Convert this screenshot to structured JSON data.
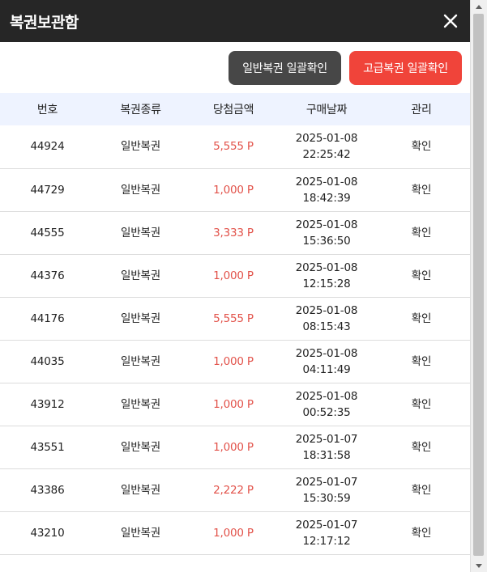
{
  "header": {
    "title": "복권보관함",
    "close_icon": "close-icon"
  },
  "toolbar": {
    "normal_confirm_label": "일반복권 일괄확인",
    "premium_confirm_label": "고급복권 일괄확인"
  },
  "table": {
    "headers": [
      "번호",
      "복권종류",
      "당첨금액",
      "구매날짜",
      "관리"
    ],
    "rows": [
      {
        "number": "44924",
        "type": "일반복권",
        "amount": "5,555 P",
        "date": "2025-01-08",
        "time": "22:25:42",
        "action": "확인"
      },
      {
        "number": "44729",
        "type": "일반복권",
        "amount": "1,000 P",
        "date": "2025-01-08",
        "time": "18:42:39",
        "action": "확인"
      },
      {
        "number": "44555",
        "type": "일반복권",
        "amount": "3,333 P",
        "date": "2025-01-08",
        "time": "15:36:50",
        "action": "확인"
      },
      {
        "number": "44376",
        "type": "일반복권",
        "amount": "1,000 P",
        "date": "2025-01-08",
        "time": "12:15:28",
        "action": "확인"
      },
      {
        "number": "44176",
        "type": "일반복권",
        "amount": "5,555 P",
        "date": "2025-01-08",
        "time": "08:15:43",
        "action": "확인"
      },
      {
        "number": "44035",
        "type": "일반복권",
        "amount": "1,000 P",
        "date": "2025-01-08",
        "time": "04:11:49",
        "action": "확인"
      },
      {
        "number": "43912",
        "type": "일반복권",
        "amount": "1,000 P",
        "date": "2025-01-08",
        "time": "00:52:35",
        "action": "확인"
      },
      {
        "number": "43551",
        "type": "일반복권",
        "amount": "1,000 P",
        "date": "2025-01-07",
        "time": "18:31:58",
        "action": "확인"
      },
      {
        "number": "43386",
        "type": "일반복권",
        "amount": "2,222 P",
        "date": "2025-01-07",
        "time": "15:30:59",
        "action": "확인"
      },
      {
        "number": "43210",
        "type": "일반복권",
        "amount": "1,000 P",
        "date": "2025-01-07",
        "time": "12:17:12",
        "action": "확인"
      }
    ]
  },
  "colors": {
    "header_bg": "#262626",
    "normal_button": "#474747",
    "premium_button": "#f0443a",
    "table_header_bg": "#eef3ff",
    "amount_text": "#e2524a"
  }
}
